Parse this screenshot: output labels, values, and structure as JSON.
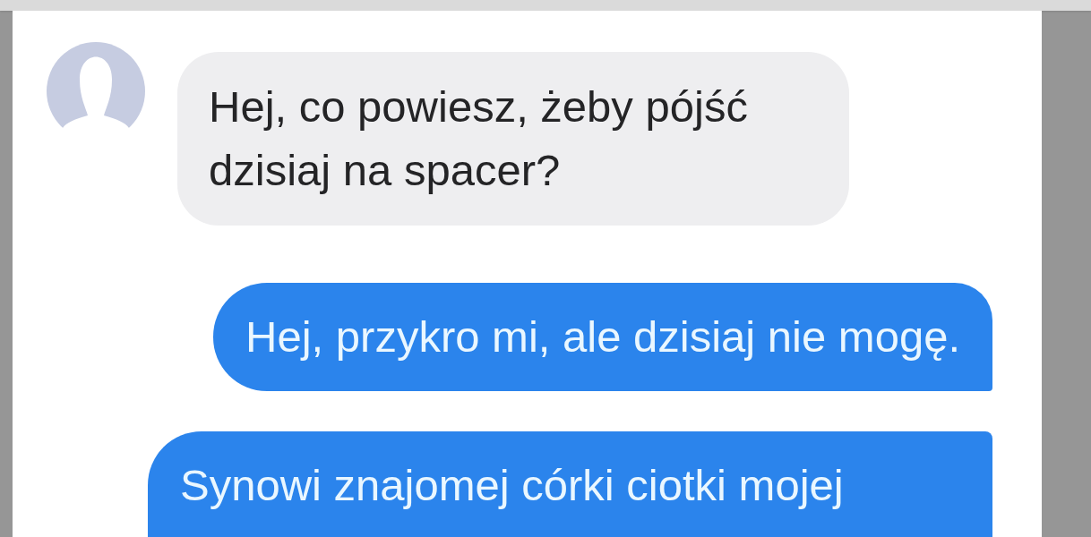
{
  "chat": {
    "messages": [
      {
        "kind": "received",
        "text": "Hej, co powiesz, żeby pójść dzisiaj na spacer?"
      },
      {
        "kind": "sent",
        "text": "Hej, przykro mi, ale dzisiaj nie mogę."
      },
      {
        "kind": "sent",
        "text": "Synowi znajomej córki ciotki mojej"
      }
    ]
  }
}
